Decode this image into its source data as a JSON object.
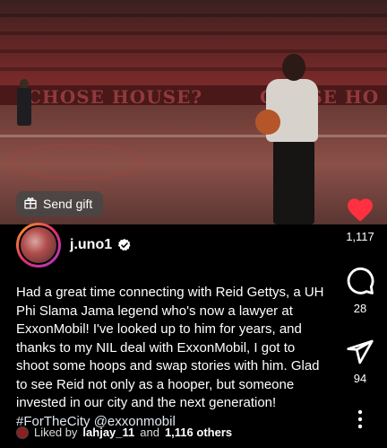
{
  "video": {
    "banner_text_left": "CHOSE HOUSE?",
    "banner_text_right": "CHOSE HO"
  },
  "gift": {
    "label": "Send gift"
  },
  "post": {
    "username": "j.uno1",
    "caption_text": "Had a great time connecting with Reid Gettys, a UH Phi Slama Jama legend who's now a lawyer at ExxonMobil! I've looked up to him for years, and thanks to my NIL deal with ExxonMobil, I got to shoot some hoops and swap stories with him. Glad to see Reid not only as a hooper, but someone  invested in our city and the next generation!",
    "hashtag": "#ForTheCity",
    "mention": "@exxonmobil"
  },
  "likes": {
    "prefix": "Liked by",
    "user": "lahjay_11",
    "connector": "and",
    "others": "1,116 others"
  },
  "actions": {
    "like_count": "1,117",
    "comment_count": "28",
    "share_count": "94"
  },
  "colors": {
    "like": "#ff3040",
    "verified": "#ffffff",
    "background": "#000000"
  }
}
